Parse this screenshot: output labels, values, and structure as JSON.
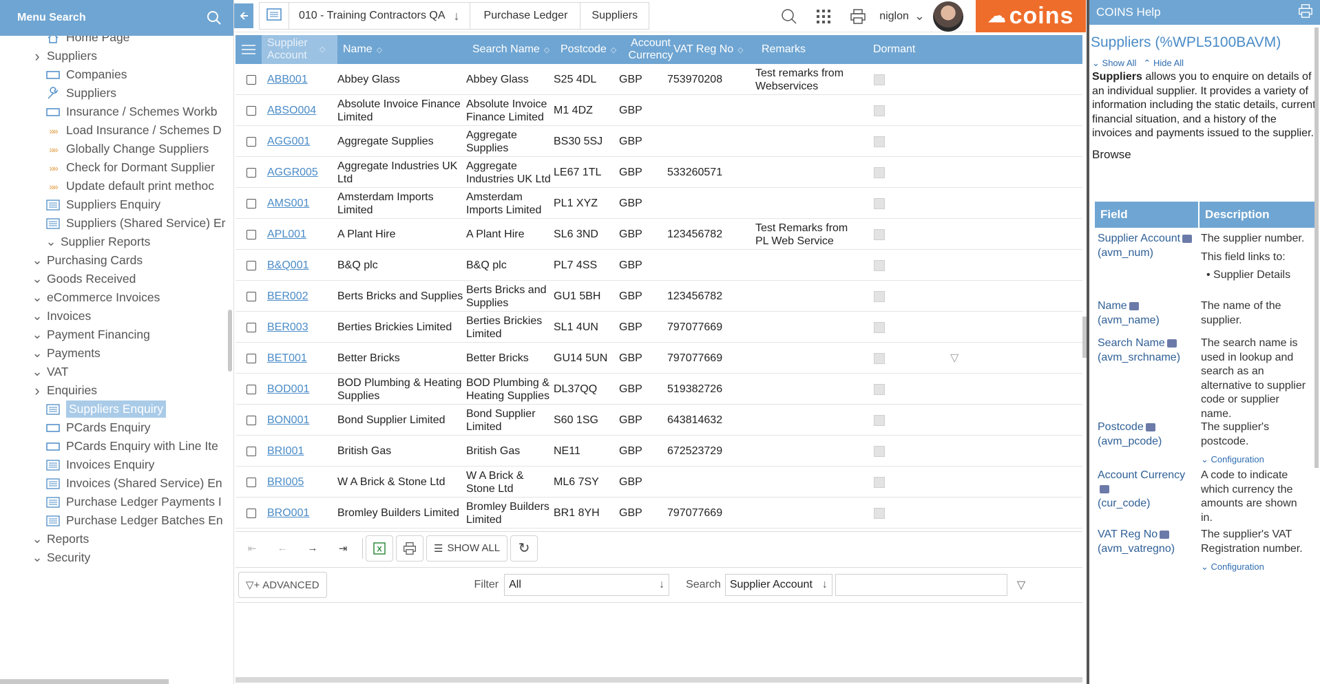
{
  "sidebar": {
    "menu_search_label": "Menu Search",
    "items": [
      {
        "label": "Home Page",
        "icon": "home-icon",
        "chev": ""
      },
      {
        "label": "Suppliers",
        "icon": "",
        "chev": "›"
      },
      {
        "label": "Companies",
        "icon": "form-icon",
        "chev": ""
      },
      {
        "label": "Suppliers",
        "icon": "wrench-icon",
        "chev": ""
      },
      {
        "label": "Insurance / Schemes Workb",
        "icon": "form-icon",
        "chev": ""
      },
      {
        "label": "Load Insurance / Schemes D",
        "icon": "process-icon",
        "chev": ""
      },
      {
        "label": "Globally Change Suppliers",
        "icon": "process-icon",
        "chev": ""
      },
      {
        "label": "Check for Dormant Supplier",
        "icon": "process-icon",
        "chev": ""
      },
      {
        "label": "Update default print methoc",
        "icon": "process-icon",
        "chev": ""
      },
      {
        "label": "Suppliers Enquiry",
        "icon": "list-icon",
        "chev": ""
      },
      {
        "label": "Suppliers (Shared Service) Er",
        "icon": "list-icon",
        "chev": ""
      },
      {
        "label": "Supplier Reports",
        "icon": "",
        "chev": "⌄"
      },
      {
        "label": "Purchasing Cards",
        "icon": "",
        "chev": "⌄"
      },
      {
        "label": "Goods Received",
        "icon": "",
        "chev": "⌄"
      },
      {
        "label": "eCommerce Invoices",
        "icon": "",
        "chev": "⌄"
      },
      {
        "label": "Invoices",
        "icon": "",
        "chev": "⌄"
      },
      {
        "label": "Payment Financing",
        "icon": "",
        "chev": "⌄"
      },
      {
        "label": "Payments",
        "icon": "",
        "chev": "⌄"
      },
      {
        "label": "VAT",
        "icon": "",
        "chev": "⌄"
      },
      {
        "label": "Enquiries",
        "icon": "",
        "chev": "›"
      },
      {
        "label": "Suppliers Enquiry",
        "icon": "list-icon",
        "chev": ""
      },
      {
        "label": "PCards Enquiry",
        "icon": "form-icon",
        "chev": ""
      },
      {
        "label": "PCards Enquiry with Line Ite",
        "icon": "form-icon",
        "chev": ""
      },
      {
        "label": "Invoices Enquiry",
        "icon": "list-icon",
        "chev": ""
      },
      {
        "label": "Invoices (Shared Service) En",
        "icon": "list-icon",
        "chev": ""
      },
      {
        "label": "Purchase Ledger Payments I",
        "icon": "list-icon",
        "chev": ""
      },
      {
        "label": "Purchase Ledger Batches En",
        "icon": "list-icon",
        "chev": ""
      },
      {
        "label": "Reports",
        "icon": "",
        "chev": "⌄"
      },
      {
        "label": "Security",
        "icon": "",
        "chev": "⌄"
      }
    ]
  },
  "topbar": {
    "breadcrumbs": [
      "010 - Training Contractors QA",
      "Purchase Ledger",
      "Suppliers"
    ],
    "user": "niglon",
    "logo_text": "coins"
  },
  "grid": {
    "headers": [
      "Supplier Account",
      "Name",
      "Search Name",
      "Postcode",
      "Account Currency",
      "VAT Reg No",
      "Remarks",
      "Dormant"
    ],
    "rows": [
      {
        "account": "ABB001",
        "name": "Abbey Glass",
        "search": "Abbey Glass",
        "postcode": "S25 4DL",
        "currency": "GBP",
        "vat": "753970208",
        "remarks": "Test remarks from Webservices"
      },
      {
        "account": "ABSO004",
        "name": "Absolute Invoice Finance Limited",
        "search": "Absolute Invoice Finance Limited",
        "postcode": "M1 4DZ",
        "currency": "GBP",
        "vat": "",
        "remarks": ""
      },
      {
        "account": "AGG001",
        "name": "Aggregate Supplies",
        "search": "Aggregate Supplies",
        "postcode": "BS30 5SJ",
        "currency": "GBP",
        "vat": "",
        "remarks": ""
      },
      {
        "account": "AGGR005",
        "name": "Aggregate Industries UK Ltd",
        "search": "Aggregate Industries UK Ltd",
        "postcode": "LE67 1TL",
        "currency": "GBP",
        "vat": "533260571",
        "remarks": ""
      },
      {
        "account": "AMS001",
        "name": "Amsterdam Imports Limited",
        "search": "Amsterdam Imports Limited",
        "postcode": "PL1 XYZ",
        "currency": "GBP",
        "vat": "",
        "remarks": ""
      },
      {
        "account": "APL001",
        "name": "A Plant Hire",
        "search": "A Plant Hire",
        "postcode": "SL6 3ND",
        "currency": "GBP",
        "vat": "123456782",
        "remarks": "Test Remarks from PL Web Service"
      },
      {
        "account": "B&Q001",
        "name": "B&Q plc",
        "search": "B&Q plc",
        "postcode": "PL7 4SS",
        "currency": "GBP",
        "vat": "",
        "remarks": ""
      },
      {
        "account": "BER002",
        "name": "Berts Bricks and Supplies",
        "search": "Berts Bricks and Supplies",
        "postcode": "GU1 5BH",
        "currency": "GBP",
        "vat": "123456782",
        "remarks": ""
      },
      {
        "account": "BER003",
        "name": "Berties Brickies Limited",
        "search": "Berties Brickies Limited",
        "postcode": "SL1 4UN",
        "currency": "GBP",
        "vat": "797077669",
        "remarks": ""
      },
      {
        "account": "BET001",
        "name": "Better Bricks",
        "search": "Better Bricks",
        "postcode": "GU14 5UN",
        "currency": "GBP",
        "vat": "797077669",
        "remarks": ""
      },
      {
        "account": "BOD001",
        "name": "BOD Plumbing & Heating Supplies",
        "search": "BOD Plumbing & Heating Supplies",
        "postcode": "DL37QQ",
        "currency": "GBP",
        "vat": "519382726",
        "remarks": ""
      },
      {
        "account": "BON001",
        "name": "Bond Supplier Limited",
        "search": "Bond Supplier Limited",
        "postcode": "S60 1SG",
        "currency": "GBP",
        "vat": "643814632",
        "remarks": ""
      },
      {
        "account": "BRI001",
        "name": "British Gas",
        "search": "British Gas",
        "postcode": "NE11",
        "currency": "GBP",
        "vat": "672523729",
        "remarks": ""
      },
      {
        "account": "BRI005",
        "name": "W A Brick & Stone Ltd",
        "search": "W A Brick & Stone Ltd",
        "postcode": "ML6 7SY",
        "currency": "GBP",
        "vat": "",
        "remarks": ""
      },
      {
        "account": "BRO001",
        "name": "Bromley Builders Limited",
        "search": "Bromley Builders Limited",
        "postcode": "BR1 8YH",
        "currency": "GBP",
        "vat": "797077669",
        "remarks": ""
      }
    ]
  },
  "pager": {
    "show_all": "SHOW ALL"
  },
  "filterbar": {
    "advanced": "ADVANCED",
    "filter_label": "Filter",
    "filter_value": "All",
    "search_label": "Search",
    "search_field": "Supplier Account",
    "search_value": ""
  },
  "help": {
    "header": "COINS Help",
    "title": "Suppliers (%WPL5100BAVM)",
    "show_all": "Show All",
    "hide_all": "Hide All",
    "intro_bold": "Suppliers",
    "intro_text": " allows you to enquire on details of an individual supplier. It provides a variety of information including the static details, current financial situation, and a history of the invoices and payments issued to the supplier.",
    "browse": "Browse",
    "col_field": "Field",
    "col_desc": "Description",
    "fields": [
      {
        "field": "Supplier Account",
        "code": "(avm_num)",
        "desc": "The supplier number.",
        "extra": "This field links to:",
        "bullet": "Supplier Details",
        "config": ""
      },
      {
        "field": "Name",
        "code": "(avm_name)",
        "desc": "The name of the supplier.",
        "extra": "",
        "bullet": "",
        "config": ""
      },
      {
        "field": "Search Name",
        "code": "(avm_srchname)",
        "desc": "The search name is used in lookup and search as an alternative to supplier code or supplier name.",
        "extra": "",
        "bullet": "",
        "config": ""
      },
      {
        "field": "Postcode",
        "code": "(avm_pcode)",
        "desc": "The supplier's postcode.",
        "extra": "",
        "bullet": "",
        "config": "Configuration"
      },
      {
        "field": "Account Currency",
        "code": "(cur_code)",
        "desc": "A code to indicate which currency the amounts are shown in.",
        "extra": "",
        "bullet": "",
        "config": ""
      },
      {
        "field": "VAT Reg No",
        "code": "(avm_vatregno)",
        "desc": "The supplier's VAT Registration number.",
        "extra": "",
        "bullet": "",
        "config": "Configuration"
      }
    ]
  },
  "colors": {
    "header_blue": "#6fa5d2",
    "link_blue": "#4a8bc7",
    "coins_orange": "#ef6d2b"
  }
}
